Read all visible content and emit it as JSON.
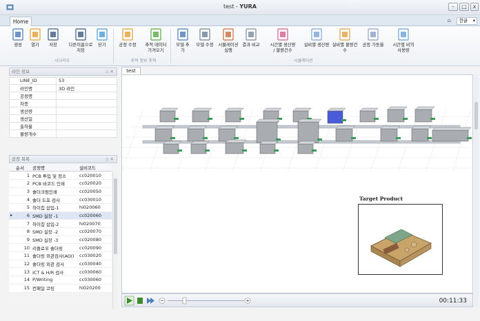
{
  "window": {
    "title_prefix": "test - ",
    "title_app": "YURA",
    "min": "–",
    "max": "□",
    "close": "x"
  },
  "tabs": {
    "home": "Home",
    "lang": "한글"
  },
  "ribbon": {
    "buttons": [
      {
        "label": "생성",
        "icon": "new-doc-icon"
      },
      {
        "label": "열기",
        "icon": "open-folder-icon"
      },
      {
        "label": "저장",
        "icon": "save-icon"
      },
      {
        "label": "다른이름으로\n저장",
        "icon": "save-as-icon"
      },
      {
        "label": "닫기",
        "icon": "close-doc-icon"
      },
      {
        "label": "공정 수정",
        "icon": "process-edit-icon"
      },
      {
        "label": "추적 데이터\n가져오기",
        "icon": "import-icon"
      },
      {
        "label": "모델 추가",
        "icon": "model-add-icon"
      },
      {
        "label": "모델 수정",
        "icon": "model-edit-icon"
      },
      {
        "label": "시뮬레이션\n실행",
        "icon": "run-sim-icon"
      },
      {
        "label": "결과 비교",
        "icon": "compare-icon"
      },
      {
        "label": "시간별 생산량\n/ 불량건수",
        "icon": "line-chart-icon"
      },
      {
        "label": "설비별 생산량",
        "icon": "bar-chart-icon"
      },
      {
        "label": "설비별 불량건수",
        "icon": "bar-chart-2-icon"
      },
      {
        "label": "공정 가동율",
        "icon": "bar-chart-3-icon"
      },
      {
        "label": "시간별 비의\n사용량",
        "icon": "bar-chart-4-icon"
      }
    ],
    "groups": {
      "scenario": "시나리오",
      "tracking": "추적 정보 추적",
      "simulation": "시뮬레이션"
    }
  },
  "line_info": {
    "header": "라인 정보",
    "rows": [
      {
        "key": "LINE_ID",
        "value": "53"
      },
      {
        "key": "라인명",
        "value": "3D 라인"
      },
      {
        "key": "공정명",
        "value": ""
      },
      {
        "key": "차종",
        "value": ""
      },
      {
        "key": "생산량",
        "value": ""
      },
      {
        "key": "생산일",
        "value": ""
      },
      {
        "key": "출하율",
        "value": ""
      },
      {
        "key": "불량개수",
        "value": ""
      }
    ]
  },
  "process_list": {
    "header": "공정 목록",
    "col_no": "순서",
    "col_name": "공정명",
    "col_code": "설비코드",
    "rows": [
      {
        "no": "1",
        "name": "PCB 투입 및 정소",
        "code": "cc020010"
      },
      {
        "no": "2",
        "name": "PCB 바코드 인쇄",
        "code": "cc020020"
      },
      {
        "no": "3",
        "name": "솔더크림인쇄",
        "code": "cc020050"
      },
      {
        "no": "4",
        "name": "솔더 도포 검사",
        "code": "cc030010"
      },
      {
        "no": "5",
        "name": "하이칩 삽입-1",
        "code": "hi020060"
      },
      {
        "no": "6",
        "name": "SMD 실장 -1",
        "code": "cc020060"
      },
      {
        "no": "7",
        "name": "하이칩 삽입-2",
        "code": "hi020070"
      },
      {
        "no": "8",
        "name": "SMD 실장 -2",
        "code": "cc020070"
      },
      {
        "no": "9",
        "name": "SMD 실장 -3",
        "code": "cc020080"
      },
      {
        "no": "10",
        "name": "리플로우 솔더링",
        "code": "cc020090"
      },
      {
        "no": "11",
        "name": "솔더링 외관검사(AOI)",
        "code": "cc030020"
      },
      {
        "no": "12",
        "name": "솔더링 외관 검사",
        "code": "cc030040"
      },
      {
        "no": "13",
        "name": "ICT & H/R 검사",
        "code": "cc030060"
      },
      {
        "no": "14",
        "name": "P/Writing",
        "code": "cc030060"
      },
      {
        "no": "15",
        "name": "컨페일 코팅",
        "code": "hi020200"
      }
    ],
    "selected_index": 5
  },
  "viewport": {
    "tab": "test",
    "target_title": "Target Product"
  },
  "playback": {
    "time": "00:11:33"
  }
}
